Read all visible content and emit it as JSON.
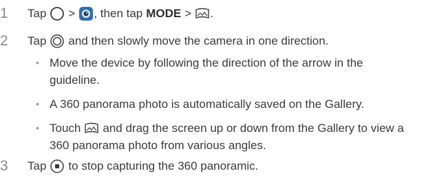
{
  "steps": {
    "s1": {
      "num": "1",
      "tap": "Tap",
      "gt1": ">",
      "then_tap": ", then tap",
      "mode": "MODE",
      "gt2": ">",
      "end": "."
    },
    "s2": {
      "num": "2",
      "tap": "Tap",
      "rest": "and then slowly move the camera in one direction."
    },
    "s3": {
      "num": "3",
      "tap": "Tap",
      "rest": "to stop capturing the 360 panoramic."
    }
  },
  "bullets": {
    "b1": "Move the device by following the direction of the arrow in the guideline.",
    "b2": "A 360 panorama photo is automatically saved on the Gallery.",
    "b3_touch": "Touch",
    "b3_rest": "and drag the screen up or down from the Gallery to view a",
    "b3_line2": "360 panorama photo from various angles.",
    "dot": "•"
  },
  "icons": {
    "home": "home-circle-icon",
    "camera": "camera-app-icon",
    "panorama": "panorama-mode-icon",
    "shutter": "shutter-icon",
    "stop": "stop-record-icon"
  },
  "colors": {
    "text": "#3a3a3a",
    "number": "#8a8a8a",
    "camera_blue": "#2f6db0"
  }
}
